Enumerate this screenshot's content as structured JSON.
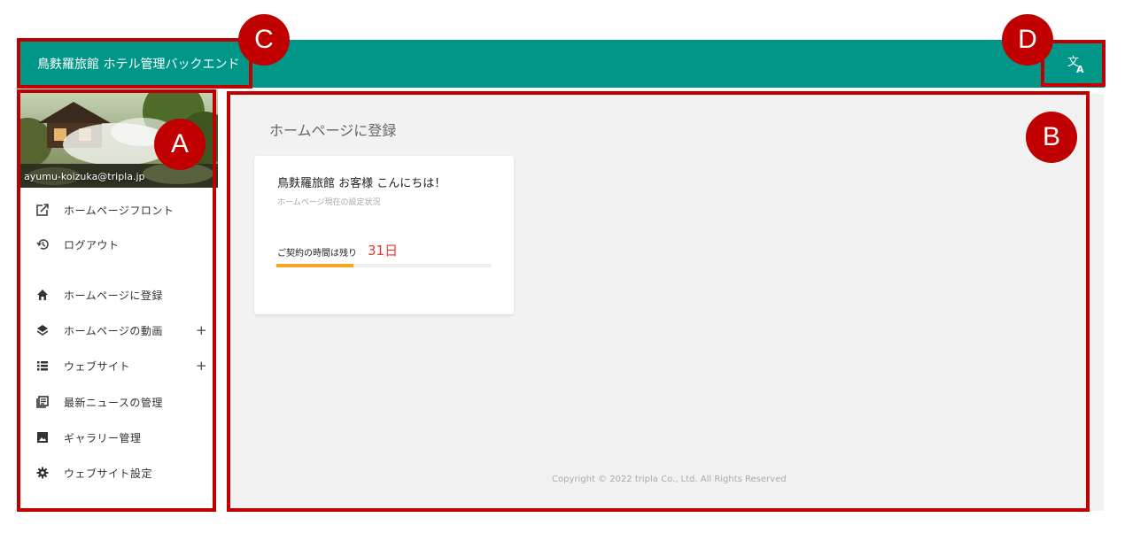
{
  "header": {
    "title": "鳥麩羅旅館 ホテル管理バックエンド",
    "translate_icon": "translate-icon",
    "color": "#009688"
  },
  "sidebar": {
    "user_email": "ayumu-koizuka@tripla.jp",
    "items": [
      {
        "label": "ホームページフロント",
        "icon": "external-link-icon"
      },
      {
        "label": "ログアウト",
        "icon": "history-icon"
      },
      {
        "label": "ホームページに登録",
        "icon": "home-icon"
      },
      {
        "label": "ホームページの動画",
        "icon": "layers-icon",
        "expand": "+"
      },
      {
        "label": "ウェブサイト",
        "icon": "list-icon",
        "expand": "+"
      },
      {
        "label": "最新ニュースの管理",
        "icon": "news-icon"
      },
      {
        "label": "ギャラリー管理",
        "icon": "image-icon"
      },
      {
        "label": "ウェブサイト設定",
        "icon": "gear-icon"
      }
    ]
  },
  "main": {
    "page_title": "ホームページに登録",
    "card": {
      "greeting": "鳥麩羅旅館 お客様 こんにちは！",
      "subtitle": "ホームページ現在の設定状況",
      "contract_label": "ご契約の時間は残り",
      "days_remaining": "31日",
      "progress_fraction": 0.36
    },
    "copyright": "Copyright © 2022 tripla Co., Ltd. All Rights Reserved"
  },
  "annotations": {
    "color": "#c00000",
    "labels": [
      "A",
      "B",
      "C",
      "D"
    ]
  }
}
